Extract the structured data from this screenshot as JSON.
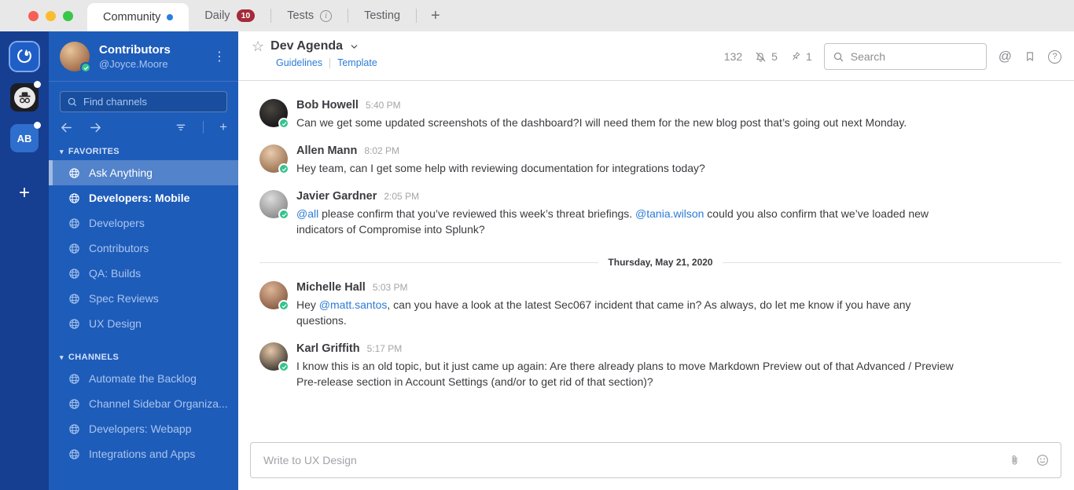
{
  "titlebar": {
    "tabs": [
      {
        "label": "Community",
        "active": true,
        "unread_dot": true
      },
      {
        "label": "Daily",
        "badge": "10"
      },
      {
        "label": "Tests",
        "has_info_icon": true
      },
      {
        "label": "Testing"
      }
    ],
    "new_tab_label": "+"
  },
  "rail": {
    "workspace_initials": "AB",
    "add_workspace_label": "+"
  },
  "sidebar": {
    "team_name": "Contributors",
    "user_handle": "@Joyce.Moore",
    "search_placeholder": "Find channels",
    "sections": [
      {
        "label": "FAVORITES",
        "channels": [
          {
            "name": "Ask Anything",
            "state": "active"
          },
          {
            "name": "Developers: Mobile",
            "state": "unread"
          },
          {
            "name": "Developers"
          },
          {
            "name": "Contributors"
          },
          {
            "name": "QA: Builds"
          },
          {
            "name": "Spec Reviews"
          },
          {
            "name": "UX Design"
          }
        ]
      },
      {
        "label": "CHANNELS",
        "channels": [
          {
            "name": "Automate the Backlog"
          },
          {
            "name": "Channel Sidebar Organiza..."
          },
          {
            "name": "Developers: Webapp"
          },
          {
            "name": "Integrations and Apps"
          }
        ]
      }
    ]
  },
  "header": {
    "channel_name": "Dev Agenda",
    "links": [
      {
        "label": "Guidelines"
      },
      {
        "label": "Template"
      }
    ],
    "member_count": "132",
    "muted_count": "5",
    "pinned_count": "1",
    "search_placeholder": "Search"
  },
  "conversation": {
    "date_divider": "Thursday, May 21, 2020",
    "messages": [
      {
        "author": "Bob Howell",
        "time": "5:40 PM",
        "segments": [
          {
            "text": "Can we get some updated screenshots of the dashboard?I will need them for the new blog post that’s going out next Monday."
          }
        ]
      },
      {
        "author": "Allen Mann",
        "time": "8:02 PM",
        "segments": [
          {
            "text": "Hey team, can I get some help with reviewing documentation for integrations today?"
          }
        ]
      },
      {
        "author": "Javier Gardner",
        "time": "2:05 PM",
        "segments": [
          {
            "text": "@all",
            "type": "mention"
          },
          {
            "text": " please confirm that you’ve reviewed this week’s threat briefings. "
          },
          {
            "text": "@tania.wilson",
            "type": "mention"
          },
          {
            "text": " could you also confirm that we’ve loaded new indicators of Compromise into Splunk?"
          }
        ]
      },
      {
        "author": "Michelle Hall",
        "time": "5:03 PM",
        "segments": [
          {
            "text": "Hey "
          },
          {
            "text": "@matt.santos",
            "type": "mention"
          },
          {
            "text": ", can you have a look at the latest Sec067 incident that came in? As always, do let me know if you have any questions."
          }
        ]
      },
      {
        "author": "Karl Griffith",
        "time": "5:17 PM",
        "segments": [
          {
            "text": "I know this is an old topic, but it just came up again: Are there already plans to move Markdown Preview out of that Advanced / Preview Pre-release section in Account Settings (and/or to get rid of that section)?"
          }
        ]
      }
    ]
  },
  "composer": {
    "placeholder": "Write to UX Design"
  },
  "icons": {
    "titlebar": [
      "close-window",
      "minimize-window",
      "zoom-window",
      "info-icon"
    ],
    "rail": [
      "mattermost-logo-icon",
      "incognito-avatar-icon",
      "add-workspace-icon"
    ],
    "sidebar": [
      "verified-badge-icon",
      "kebab-menu-icon",
      "search-icon",
      "back-arrow-icon",
      "forward-arrow-icon",
      "filter-icon",
      "add-channel-icon",
      "chevron-down-icon",
      "globe-icon"
    ],
    "header": [
      "star-icon",
      "chevron-down-icon",
      "bell-off-icon",
      "pin-icon",
      "search-icon",
      "at-mention-icon",
      "bookmark-icon",
      "help-icon"
    ],
    "composer": [
      "paperclip-icon",
      "emoji-icon"
    ]
  },
  "colors": {
    "rail_blue": "#163e91",
    "sidebar_blue": "#1e5cba",
    "selected_channel": "rgba(255,255,255,0.24)",
    "link_blue": "#2b7bd6",
    "unread_dot_blue": "#2b7de0",
    "badge_red": "#a52a3a",
    "online_green": "#35c48e"
  }
}
